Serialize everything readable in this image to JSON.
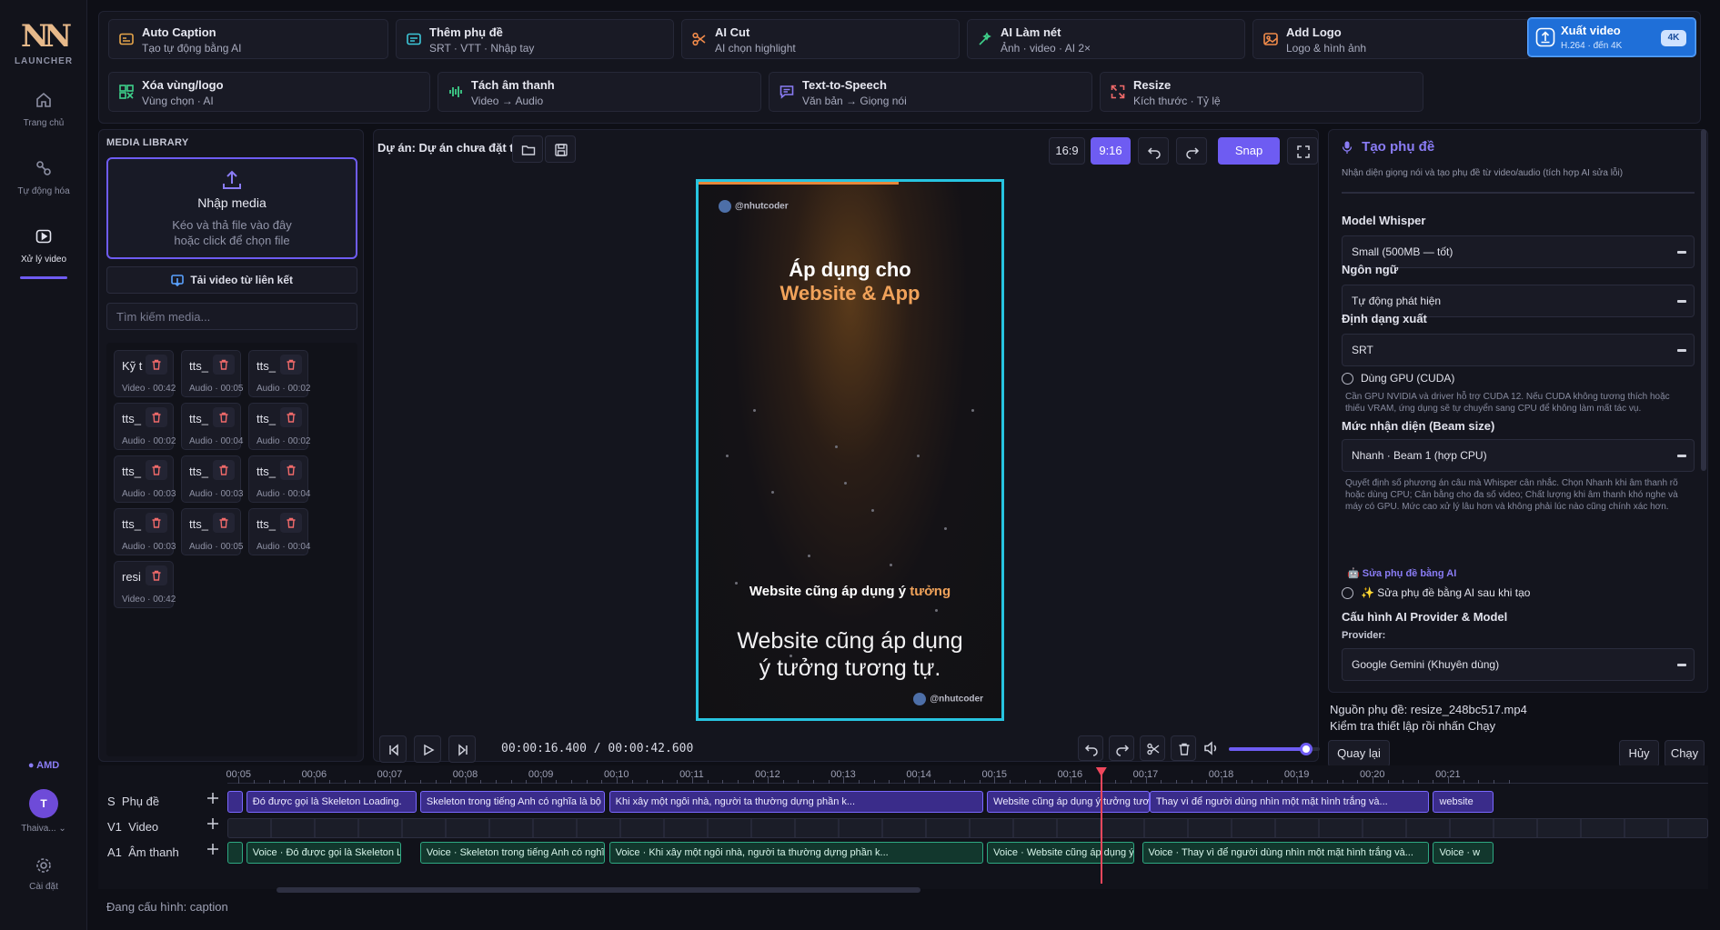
{
  "rail": {
    "logo": "NN",
    "logo_sub": "LAUNCHER",
    "items": [
      {
        "label": "Trang chủ",
        "icon": "home-icon"
      },
      {
        "label": "Tự động hóa",
        "icon": "automation-icon"
      },
      {
        "label": "Xử lý video",
        "icon": "video-icon"
      }
    ],
    "gpu_label": "● AMD",
    "avatar_initial": "T",
    "user_name": "Thaiva... ⌄",
    "settings_label": "Cài đặt"
  },
  "tools": [
    {
      "title": "Auto Caption",
      "sub": "Tạo tự động bằng AI",
      "icon": "caption-icon"
    },
    {
      "title": "Thêm phụ đề",
      "sub": "SRT · VTT · Nhập tay",
      "icon": "subtitle-icon"
    },
    {
      "title": "AI Cut",
      "sub": "AI chọn highlight",
      "icon": "scissors-icon"
    },
    {
      "title": "AI Làm nét",
      "sub": "Ảnh · video · AI 2×",
      "icon": "sharpen-icon"
    },
    {
      "title": "Add Logo",
      "sub": "Logo & hình ảnh",
      "icon": "image-icon"
    },
    {
      "title": "Xuất video",
      "sub": "H.264 · đến 4K",
      "badge": "4K",
      "icon": "export-icon"
    },
    {
      "title": "Xóa vùng/logo",
      "sub": "Vùng chọn · AI",
      "icon": "erase-icon"
    },
    {
      "title": "Tách âm thanh",
      "sub": "Video → Audio",
      "icon": "waveform-icon"
    },
    {
      "title": "Text-to-Speech",
      "sub": "Văn bản → Giọng nói",
      "icon": "speech-icon"
    },
    {
      "title": "Resize",
      "sub": "Kích thước · Tỷ lệ",
      "icon": "resize-icon"
    }
  ],
  "media": {
    "title": "MEDIA LIBRARY",
    "drop_title": "Nhập media",
    "drop_hint_1": "Kéo và thả file vào đây",
    "drop_hint_2": "hoặc click để chọn file",
    "link_button": "Tải video từ liên kết",
    "search_placeholder": "Tìm kiếm media...",
    "items": [
      {
        "name": "Kỹ t",
        "meta": "Video · 00:42"
      },
      {
        "name": "tts_",
        "meta": "Audio · 00:05"
      },
      {
        "name": "tts_",
        "meta": "Audio · 00:02"
      },
      {
        "name": "tts_",
        "meta": "Audio · 00:02"
      },
      {
        "name": "tts_",
        "meta": "Audio · 00:04"
      },
      {
        "name": "tts_",
        "meta": "Audio · 00:02"
      },
      {
        "name": "tts_",
        "meta": "Audio · 00:03"
      },
      {
        "name": "tts_",
        "meta": "Audio · 00:03"
      },
      {
        "name": "tts_",
        "meta": "Audio · 00:04"
      },
      {
        "name": "tts_",
        "meta": "Audio · 00:03"
      },
      {
        "name": "tts_",
        "meta": "Audio · 00:05"
      },
      {
        "name": "tts_",
        "meta": "Audio · 00:04"
      },
      {
        "name": "resi",
        "meta": "Video · 00:42"
      }
    ]
  },
  "preview": {
    "project_title": "Dự án: Dự án chưa đặt tên",
    "ratio_16_9": "16:9",
    "ratio_9_16": "9:16",
    "snap_label": "Snap",
    "handle": "@nhutcoder",
    "headline_1": "Áp dụng cho",
    "headline_2": "Website & App",
    "caption_main": "Website cũng áp dụng ý",
    "caption_highlight": "tưởng",
    "caption_subtitle_1": "Website cũng áp dụng",
    "caption_subtitle_2": "ý tưởng tương tự.",
    "timecode": "00:00:16.400 / 00:00:42.600",
    "volume": 0.85
  },
  "panel": {
    "title": "Tạo phụ đề",
    "desc": "Nhận diện giọng nói và tạo phụ đề từ video/audio (tích hợp AI sửa lỗi)",
    "model_label": "Model Whisper",
    "model_value": "Small (500MB — tốt)",
    "lang_label": "Ngôn ngữ",
    "lang_value": "Tự động phát hiện",
    "format_label": "Định dạng xuất",
    "format_value": "SRT",
    "gpu_label": "Dùng GPU (CUDA)",
    "gpu_note": "Cần GPU NVIDIA và driver hỗ trợ CUDA 12. Nếu CUDA không tương thích hoặc thiếu VRAM, ứng dụng sẽ tự chuyển sang CPU để không làm mất tác vụ.",
    "beam_label": "Mức nhận diện (Beam size)",
    "beam_value": "Nhanh · Beam 1 (hợp CPU)",
    "beam_note": "Quyết định số phương án câu mà Whisper cân nhắc. Chọn Nhanh khi âm thanh rõ hoặc dùng CPU; Cân bằng cho đa số video; Chất lượng khi âm thanh khó nghe và máy có GPU. Mức cao xử lý lâu hơn và không phải lúc nào cũng chính xác hơn.",
    "ai_section": "🤖 Sửa phụ đề bằng AI",
    "ai_fix_label": "✨ Sửa phụ đề bằng AI sau khi tạo",
    "provider_section": "Cấu hình AI Provider & Model",
    "provider_label": "Provider:",
    "provider_value": "Google Gemini (Khuyên dùng)"
  },
  "footer_panel": {
    "source_line": "Nguồn phụ đề: resize_248bc517.mp4",
    "hint_line": "Kiểm tra thiết lập rồi nhấn Chạy",
    "back_button": "Quay lại",
    "cancel_button": "Hủy",
    "run_button": "Chạy"
  },
  "timeline": {
    "ticks": [
      "00:05",
      "00:06",
      "00:07",
      "00:08",
      "00:09",
      "00:10",
      "00:11",
      "00:12",
      "00:13",
      "00:14",
      "00:15",
      "00:16",
      "00:17",
      "00:18",
      "00:19",
      "00:20",
      "00:21"
    ],
    "tracks": [
      {
        "id": "S",
        "label": "Phụ đề"
      },
      {
        "id": "V1",
        "label": "Video"
      },
      {
        "id": "A1",
        "label": "Âm thanh"
      }
    ],
    "subtitle_clips": [
      {
        "text": "",
        "start": 4.85,
        "end": 5.05
      },
      {
        "text": "Đó được gọi là Skeleton Loading.",
        "start": 5.1,
        "end": 7.35
      },
      {
        "text": "Skeleton trong tiếng Anh có nghĩa là bộ khung...",
        "start": 7.4,
        "end": 9.85
      },
      {
        "text": "Khi xây một ngôi nhà, người ta thường dựng phần k...",
        "start": 9.9,
        "end": 14.85
      },
      {
        "text": "Website cũng áp dụng ý tưởng tương",
        "start": 14.9,
        "end": 17.05
      },
      {
        "text": "Thay vì để người dùng nhìn một mặt hình trắng và...",
        "start": 17.05,
        "end": 20.75
      },
      {
        "text": "website",
        "start": 20.8,
        "end": 21.6
      }
    ],
    "audio_clips": [
      {
        "text": "",
        "start": 4.85,
        "end": 5.05
      },
      {
        "text": "Voice · Đó được gọi là Skeleton Loading",
        "start": 5.1,
        "end": 7.15
      },
      {
        "text": "Voice · Skeleton trong tiếng Anh có nghĩa là bộ khung",
        "start": 7.4,
        "end": 9.85
      },
      {
        "text": "Voice · Khi xây một ngôi nhà, người ta thường dựng phần k...",
        "start": 9.9,
        "end": 14.85
      },
      {
        "text": "Voice · Website cũng áp dụng ý tưởng",
        "start": 14.9,
        "end": 16.85
      },
      {
        "text": "Voice · Thay vì để người dùng nhìn một mặt hình trắng và...",
        "start": 16.95,
        "end": 20.75
      },
      {
        "text": "Voice · w",
        "start": 20.8,
        "end": 21.6
      }
    ],
    "playhead_time": 16.4
  },
  "status": "Đang cấu hình: caption"
}
